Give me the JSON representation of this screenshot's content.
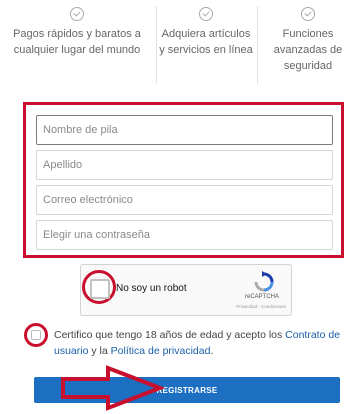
{
  "features": [
    {
      "icon": "check-circle-icon",
      "line1": "Pagos rápidos y baratos a",
      "line2": "cualquier lugar del mundo",
      "line3": ""
    },
    {
      "icon": "check-circle-icon",
      "line1": "Adquiera artículos",
      "line2": "y servicios en línea",
      "line3": ""
    },
    {
      "icon": "check-circle-icon",
      "line1": "Funciones",
      "line2": "avanzadas de",
      "line3": "seguridad"
    }
  ],
  "form": {
    "first_name_placeholder": "Nombre de pila",
    "last_name_placeholder": "Apellido",
    "email_placeholder": "Correo electrónico",
    "password_placeholder": "Elegir una contraseña"
  },
  "captcha": {
    "label": "No soy un robot",
    "brand": "reCAPTCHA",
    "links": "Privacidad - Condiciones"
  },
  "certify": {
    "text_before": "Certifico que tengo 18 años de edad y acepto los ",
    "contract_link": "Contrato de usuario",
    "text_between": " y la ",
    "privacy_link": "Política de privacidad",
    "text_after": "."
  },
  "register_button": "REGISTRARSE",
  "colors": {
    "annotation_red": "#c8102e",
    "button_blue": "#1d6fc1",
    "link_blue": "#1a5fa8"
  }
}
